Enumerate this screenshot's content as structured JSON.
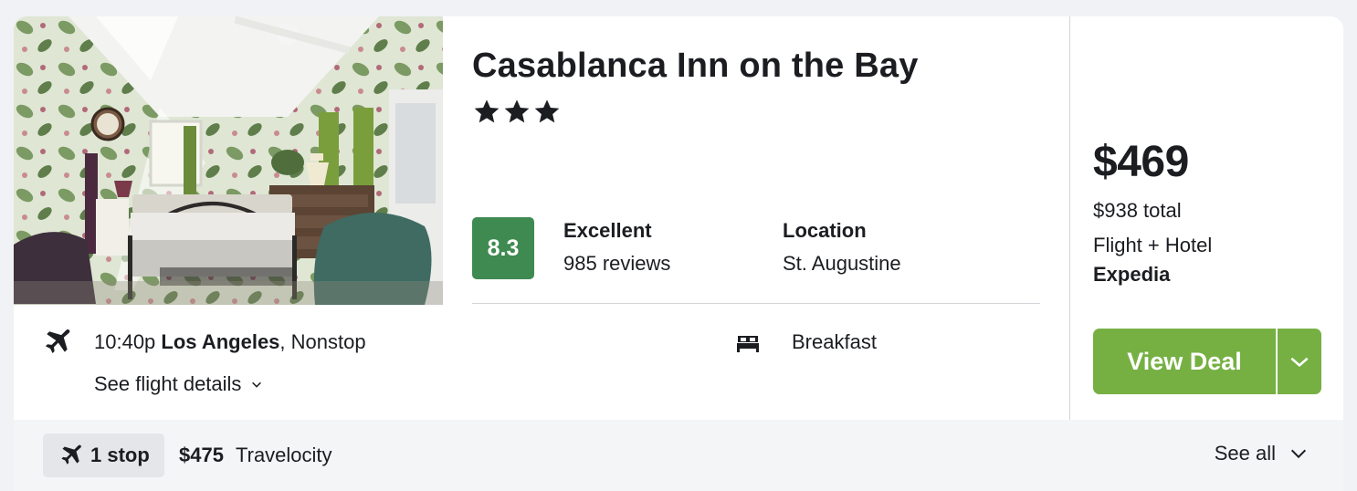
{
  "hotel": {
    "name": "Casablanca Inn on the Bay",
    "star_rating": 3,
    "stars_text": "★★★",
    "score": "8.3",
    "rating_word": "Excellent",
    "review_count": "985 reviews",
    "location_label": "Location",
    "location_value": "St. Augustine",
    "amenity": "Breakfast",
    "image_alt": "Hotel room photo"
  },
  "flight": {
    "time": "10:40p",
    "city": "Los Angeles",
    "type": ", Nonstop",
    "details_label": "See flight details"
  },
  "pricing": {
    "price": "$469",
    "total": "$938 total",
    "package": "Flight + Hotel",
    "provider": "Expedia",
    "cta_label": "View Deal"
  },
  "footer": {
    "stops_label": "1 stop",
    "alt_price": "$475",
    "alt_provider": "Travelocity",
    "see_all_label": "See all"
  },
  "icons": {
    "flight": "airplane-icon",
    "amenity": "bed-icon",
    "details_toggle": "chevron-down-icon"
  },
  "colors": {
    "score_badge": "#3f8a51",
    "deal_button": "#76b043",
    "footer_bg": "#f4f5f7",
    "chip_bg": "#e4e6ea"
  }
}
